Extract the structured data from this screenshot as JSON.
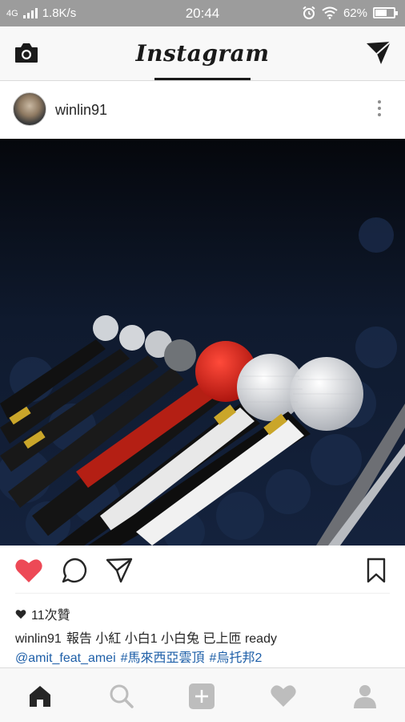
{
  "status_bar": {
    "network": "4G",
    "speed": "1.8K/s",
    "time": "20:44",
    "battery": "62%",
    "battery_level": 0.62
  },
  "header": {
    "logo": "Instagram"
  },
  "post": {
    "username": "winlin91",
    "photo_icon": "microphones-photo",
    "likes": "11次贊",
    "caption_user": "winlin91",
    "caption_text": "報告 小紅  小白1  小白兔 已上匝 ready",
    "mention": "@amit_feat_amei",
    "tag1": "#馬來西亞雲頂",
    "tag2": "#烏托邦2"
  },
  "icons": {
    "camera": "camera-icon",
    "direct": "paper-plane-icon",
    "like": "heart-icon",
    "comment": "comment-icon",
    "share": "share-icon",
    "save": "bookmark-icon",
    "home": "home-icon",
    "search": "search-icon",
    "add": "add-icon",
    "activity": "activity-heart-icon",
    "profile": "profile-icon"
  },
  "colors": {
    "like_red": "#ed4956",
    "tag_blue": "#1e5fa8",
    "status_bar_bg": "#9c9c9c"
  }
}
